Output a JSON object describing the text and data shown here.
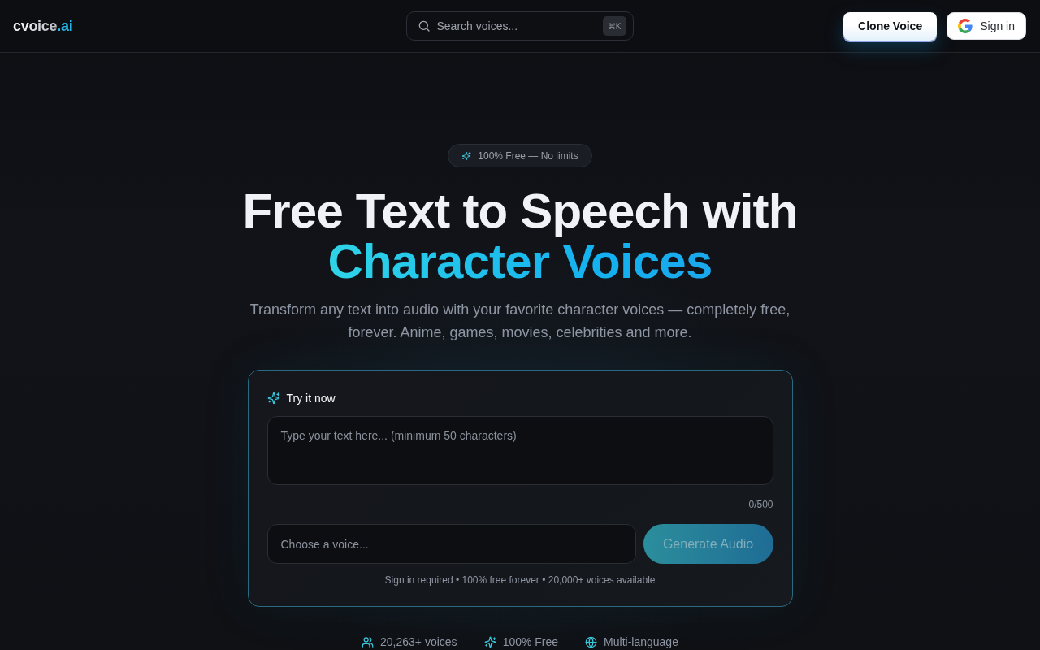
{
  "header": {
    "logo": {
      "name": "cvoice",
      "suffix": ".ai"
    },
    "search": {
      "placeholder": "Search voices...",
      "shortcut": "⌘K"
    },
    "buttons": [
      {
        "kind": "primary",
        "label": "Clone Voice"
      },
      {
        "kind": "google",
        "label": "Sign in"
      }
    ]
  },
  "hero": {
    "badge": "100% Free — No limits",
    "title": "Free Text to Speech with",
    "title_highlight": "Character Voices",
    "subtitle": "Transform any text into audio with your favorite character voices — completely free, forever. Anime, games, movies, celebrities and more."
  },
  "try_card": {
    "title": "Try it now",
    "text_field": {
      "placeholder": "Type your text here... (minimum 50 characters)"
    },
    "counter": "0/500",
    "voice_field": {
      "placeholder": "Choose a voice..."
    },
    "generate_button": {
      "label": "Generate Audio",
      "disabled": true
    },
    "note": "Sign in required • 100% free forever • 20,000+ voices available"
  },
  "stats": [
    {
      "kind": "users",
      "label": "20,263+ voices"
    },
    {
      "kind": "sparkle",
      "label": "100% Free"
    },
    {
      "kind": "globe",
      "label": "Multi-language"
    }
  ]
}
